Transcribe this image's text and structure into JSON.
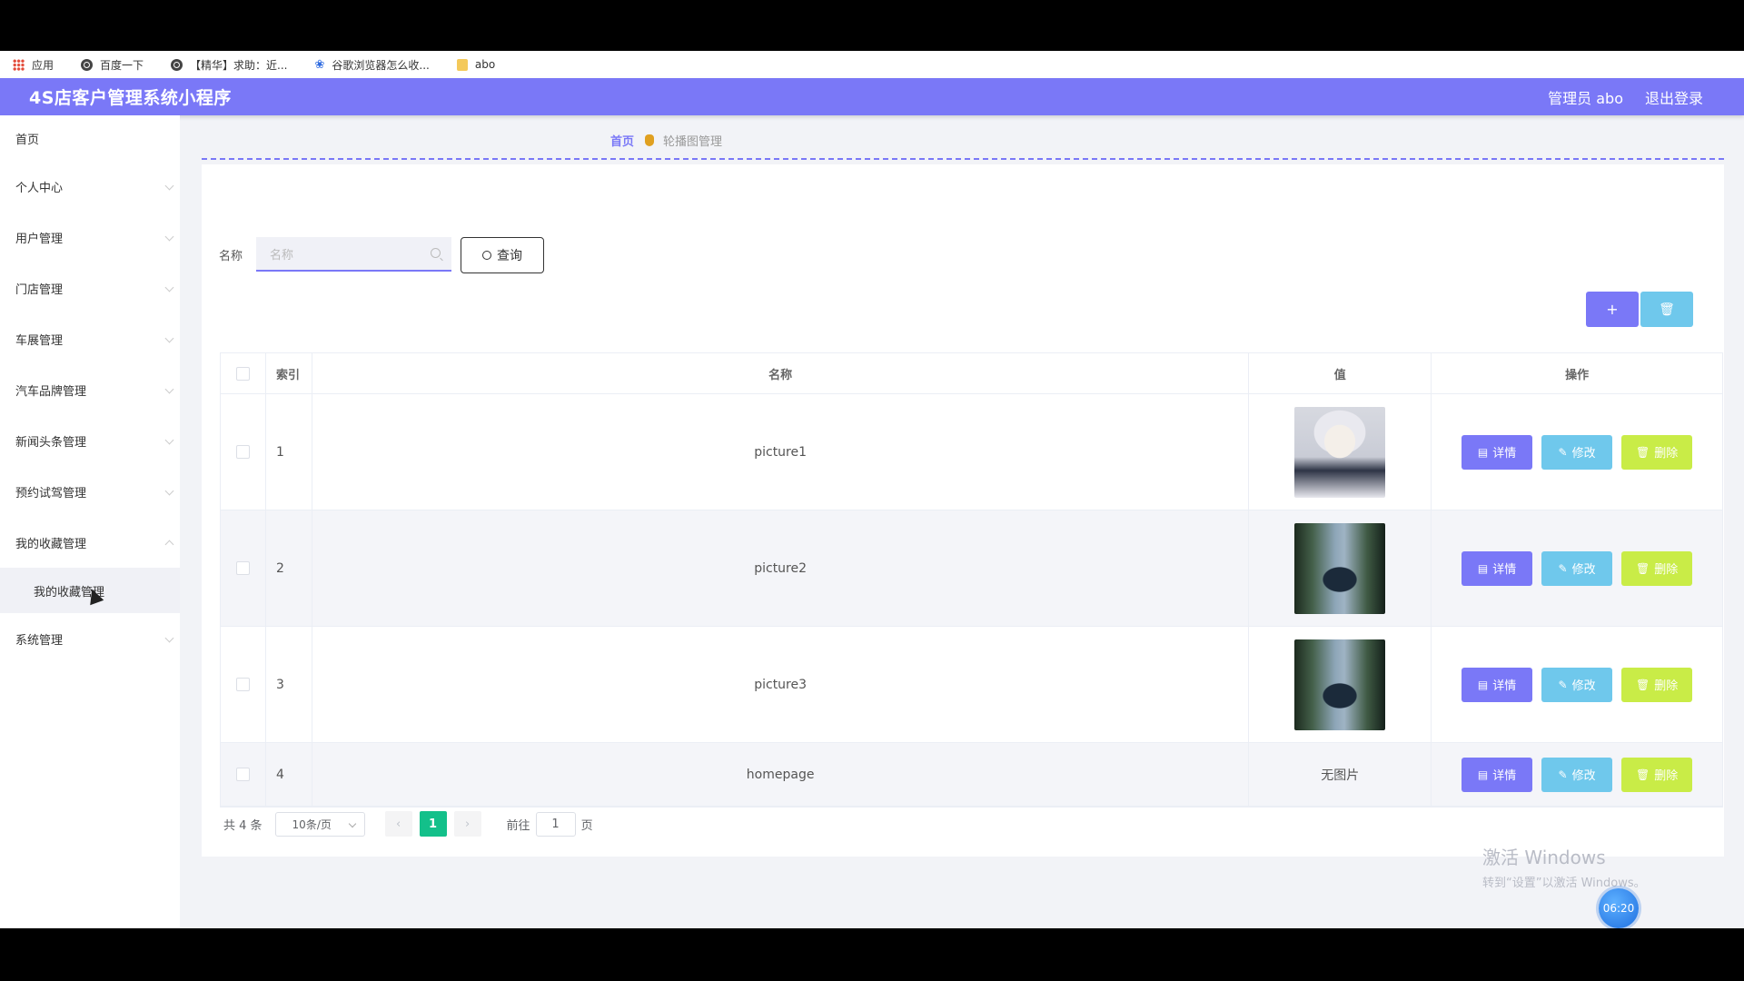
{
  "bookmarks": [
    {
      "label": "应用",
      "icon": "apps-grid-icon"
    },
    {
      "label": "百度一下",
      "icon": "globe-icon"
    },
    {
      "label": "【精华】求助：近...",
      "icon": "globe-icon"
    },
    {
      "label": "谷歌浏览器怎么收...",
      "icon": "paw-icon"
    },
    {
      "label": "abo",
      "icon": "folder-icon"
    }
  ],
  "header": {
    "title": "4S店客户管理系统小程序",
    "user": "管理员 abo",
    "logout": "退出登录"
  },
  "sidebar": {
    "items": [
      {
        "label": "首页"
      },
      {
        "label": "个人中心"
      },
      {
        "label": "用户管理"
      },
      {
        "label": "门店管理"
      },
      {
        "label": "车展管理"
      },
      {
        "label": "汽车品牌管理"
      },
      {
        "label": "新闻头条管理"
      },
      {
        "label": "预约试驾管理"
      },
      {
        "label": "我的收藏管理"
      },
      {
        "label": "系统管理"
      }
    ],
    "active_sub": "我的收藏管理"
  },
  "breadcrumb": {
    "home": "首页",
    "current": "轮播图管理"
  },
  "search": {
    "label": "名称",
    "placeholder": "名称",
    "button": "查询"
  },
  "toolbar": {
    "add_icon": "+",
    "delete_icon": "🗑"
  },
  "table": {
    "headers": [
      "索引",
      "名称",
      "值",
      "操作"
    ],
    "rows": [
      {
        "index": "1",
        "name": "picture1",
        "value_image": "anime-character"
      },
      {
        "index": "2",
        "name": "picture2",
        "value_image": "car-road"
      },
      {
        "index": "3",
        "name": "picture3",
        "value_image": "car-road"
      },
      {
        "index": "4",
        "name": "homepage",
        "value_text": "无图片"
      }
    ],
    "actions": {
      "detail": "详情",
      "edit": "修改",
      "delete": "删除"
    }
  },
  "pagination": {
    "total": "共 4 条",
    "page_size": "10条/页",
    "current_page": "1",
    "goto_prefix": "前往",
    "goto_value": "1",
    "goto_suffix": "页"
  },
  "watermark": {
    "line1": "激活 Windows",
    "line2": "转到“设置”以激活 Windows。"
  },
  "clock": "06:20",
  "colors": {
    "primary": "#7a78f7",
    "info": "#6fc8ec",
    "warn": "#c9ec47",
    "pager_active": "#13c08a"
  }
}
